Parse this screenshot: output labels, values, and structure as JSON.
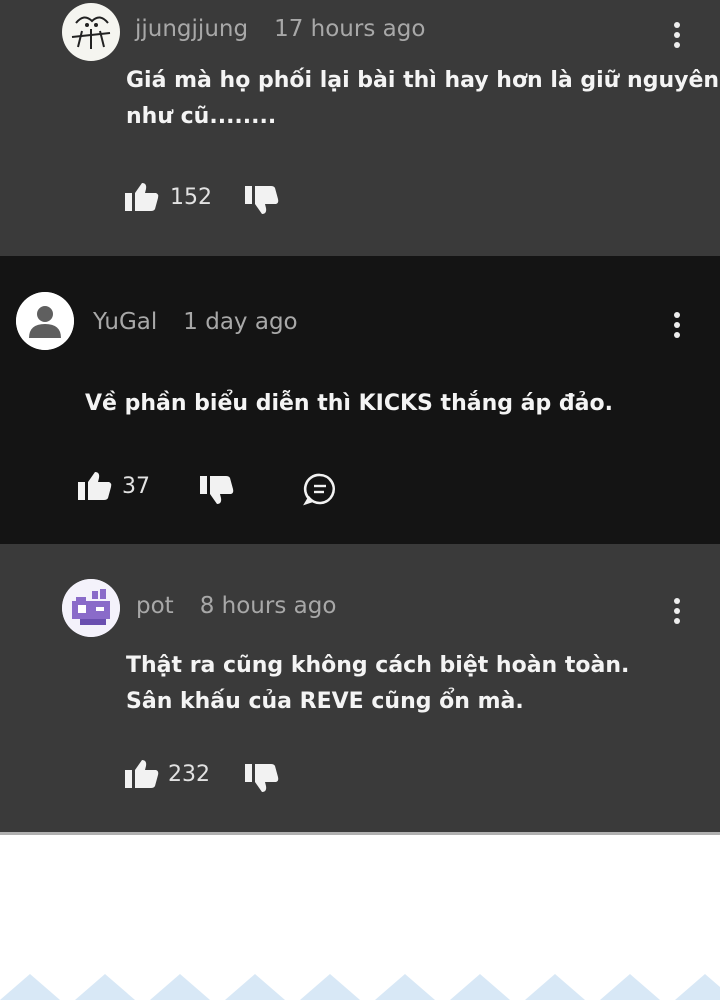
{
  "comments": [
    {
      "author": "jjungjjung",
      "time": "17 hours ago",
      "lines": [
        "Giá mà họ phối lại bài thì hay hơn là giữ nguyên",
        "như cũ........"
      ],
      "likes": "152",
      "avatar": "doodle-avatar"
    },
    {
      "author": "YuGal",
      "time": "1 day ago",
      "lines": [
        "Về phần biểu diễn thì KICKS thắng áp đảo."
      ],
      "likes": "37",
      "avatar": "default-person-avatar"
    },
    {
      "author": "pot",
      "time": "8 hours ago",
      "lines": [
        "Thật ra cũng không cách biệt hoàn toàn.",
        "Sân khấu của REVE cũng ổn mà."
      ],
      "likes": "232",
      "avatar": "pixel-art-avatar"
    }
  ],
  "icons": {
    "like": "thumbs-up-icon",
    "dislike": "thumbs-down-icon",
    "reply": "reply-icon",
    "menu": "more-vert-icon"
  },
  "colors": {
    "reply_bg": "#3a3a3a",
    "top_level_bg": "#141414",
    "text": "#f4f4f4",
    "meta": "#a8a8a8"
  }
}
